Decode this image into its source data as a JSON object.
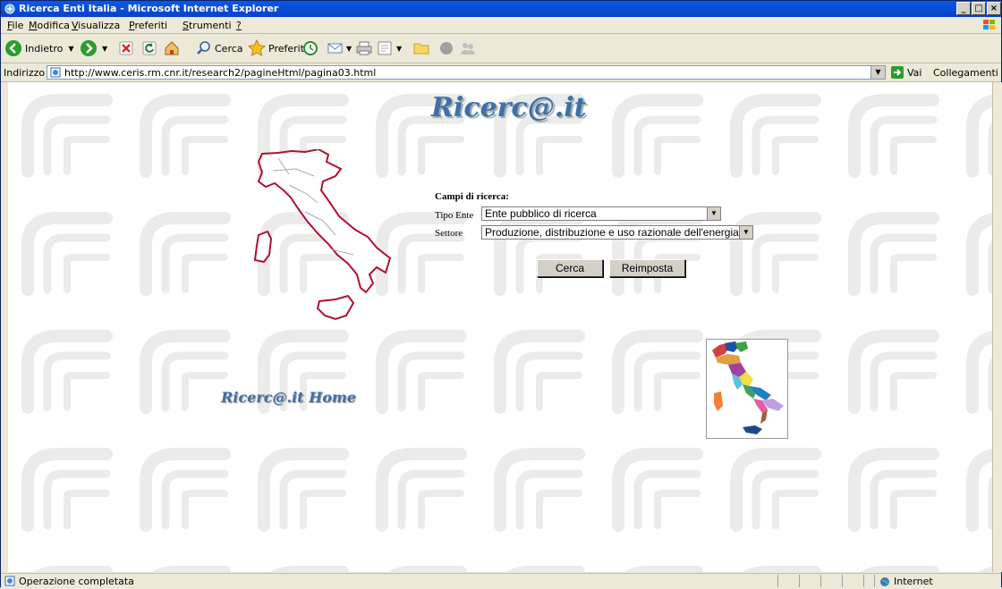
{
  "window": {
    "title": "Ricerca Enti Italia - Microsoft Internet Explorer",
    "controls": [
      "_",
      "□",
      "×"
    ]
  },
  "menu": [
    {
      "u": "F",
      "rest": "ile"
    },
    {
      "u": "M",
      "rest": "odifica"
    },
    {
      "u": "V",
      "rest": "isualizza"
    },
    {
      "u": "P",
      "rest": "referiti"
    },
    {
      "u": "S",
      "rest": "trumenti"
    },
    {
      "u": "?",
      "rest": ""
    }
  ],
  "toolbar": {
    "back": "Indietro",
    "search": "Cerca",
    "favorites": "Preferiti"
  },
  "address": {
    "label": "Indirizzo",
    "url": "http://www.ceris.rm.cnr.it/research2/pagineHtml/pagina03.html",
    "go": "Vai",
    "links": "Collegamenti"
  },
  "page": {
    "logo": "Ricerc@.it",
    "home_link": "Ricerc@.it Home",
    "form_title": "Campi di ricerca:",
    "tipo_label": "Tipo Ente",
    "tipo_value": "Ente pubblico di ricerca",
    "settore_label": "Settore",
    "settore_value": "Produzione, distribuzione e uso razionale dell'energia",
    "search_button": "Cerca",
    "reset_button": "Reimposta"
  },
  "status": {
    "text": "Operazione completata",
    "zone": "Internet"
  },
  "colors": {
    "title_blue": "#0843c4",
    "logo_blue": "#3f6fa8",
    "map_outline": "#b01030"
  }
}
